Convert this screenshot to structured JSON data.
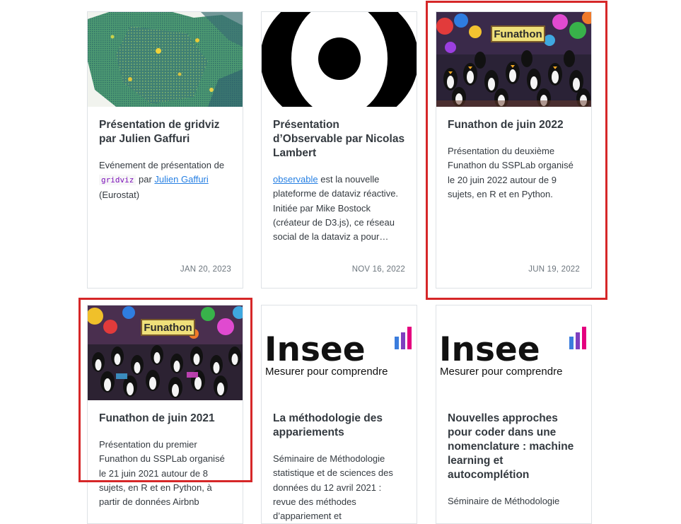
{
  "cards": [
    {
      "title": "Présentation de gridviz par Julien Gaffuri",
      "desc_pre": "Evénement de présentation de",
      "desc_code": "gridviz",
      "desc_mid": "par",
      "desc_link": "Julien Gaffuri",
      "desc_post": "(Eurostat)",
      "date": "JAN 20, 2023",
      "thumb": "france-grid-map"
    },
    {
      "title": "Présentation d’Observable par Nicolas Lambert",
      "desc_link": "observable",
      "desc_post": "est la nouvelle plateforme de dataviz réactive. Initiée par Mike Bostock (créateur de D3.js), ce réseau social de la dataviz a pour…",
      "date": "NOV 16, 2022",
      "thumb": "observable-logo"
    },
    {
      "title": "Funathon de juin 2022",
      "desc": "Présentation du deuxième Funathon du SSPLab organisé le 20 juin 2022 autour de 9 sujets, en R et en Python.",
      "date": "JUN 19, 2022",
      "thumb_text": "Funathon"
    },
    {
      "title": "Funathon de juin 2021",
      "desc": "Présentation du premier Funathon du SSPLab organisé le 21 juin 2021 autour de 8 sujets, en R et en Python, à partir de données Airbnb",
      "thumb_text": "Funathon"
    },
    {
      "title": "La méthodologie des appariements",
      "desc": "Séminaire de Méthodologie statistique et de sciences des données du 12 avril 2021 : revue des méthodes d’appariement et",
      "thumb_word": "Insee",
      "thumb_tagline": "Mesurer pour comprendre"
    },
    {
      "title": "Nouvelles approches pour coder dans une nomenclature : machine learning et autocomplétion",
      "desc": "Séminaire de Méthodologie",
      "thumb_word": "Insee",
      "thumb_tagline": "Mesurer pour comprendre"
    }
  ],
  "colors": {
    "highlight": "#d62728",
    "link": "#2780e3",
    "date": "#6c757d",
    "insee_bars": [
      "#e4007f",
      "#7e3fbf",
      "#3b7ddd"
    ]
  }
}
